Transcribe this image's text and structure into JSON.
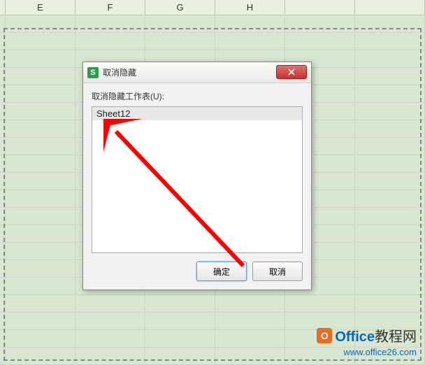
{
  "columns": [
    "E",
    "F",
    "G",
    "H"
  ],
  "dialog": {
    "title": "取消隐藏",
    "label": "取消隐藏工作表(U):",
    "items": [
      "Sheet12"
    ],
    "ok": "确定",
    "cancel": "取消"
  },
  "titlebar_icon_letter": "S",
  "watermark": {
    "logo_letter": "O",
    "brand_en": "Office",
    "brand_cn": "教程网",
    "url": "www.office26.com"
  }
}
